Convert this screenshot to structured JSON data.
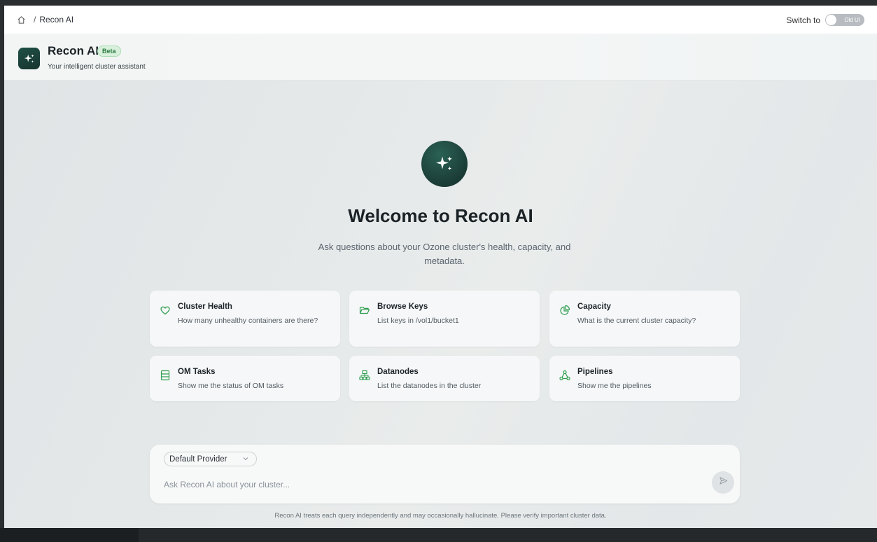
{
  "topbar": {
    "breadcrumb_home_icon": "home-icon",
    "breadcrumb_separator": "/",
    "breadcrumb_current": "Recon AI",
    "switch_label": "Switch to",
    "toggle_label": "Old UI"
  },
  "header": {
    "logo_icon": "sparkles-icon",
    "title": "Recon AI",
    "badge": "Beta",
    "subtitle": "Your intelligent cluster assistant"
  },
  "hero": {
    "icon": "sparkles-icon",
    "title": "Welcome to Recon AI",
    "tagline": "Ask questions about your Ozone cluster's health, capacity, and metadata."
  },
  "suggestions": [
    {
      "icon": "heart-icon",
      "title": "Cluster Health",
      "description": "How many unhealthy containers are there?"
    },
    {
      "icon": "folder-icon",
      "title": "Browse Keys",
      "description": "List keys in /vol1/bucket1"
    },
    {
      "icon": "pie-chart-icon",
      "title": "Capacity",
      "description": "What is the current cluster capacity?"
    },
    {
      "icon": "list-icon",
      "title": "OM Tasks",
      "description": "Show me the status of OM tasks"
    },
    {
      "icon": "network-icon",
      "title": "Datanodes",
      "description": "List the datanodes in the cluster"
    },
    {
      "icon": "workflow-icon",
      "title": "Pipelines",
      "description": "Show me the pipelines"
    }
  ],
  "composer": {
    "provider": "Default Provider",
    "placeholder": "Ask Recon AI about your cluster...",
    "send_icon": "send-icon"
  },
  "disclaimer": "Recon AI treats each query independently and may occasionally hallucinate. Please verify important cluster data.",
  "colors": {
    "accent": "#2f9e4f",
    "brand_dark": "#1b3c36",
    "badge_bg": "#d8f0dc"
  }
}
